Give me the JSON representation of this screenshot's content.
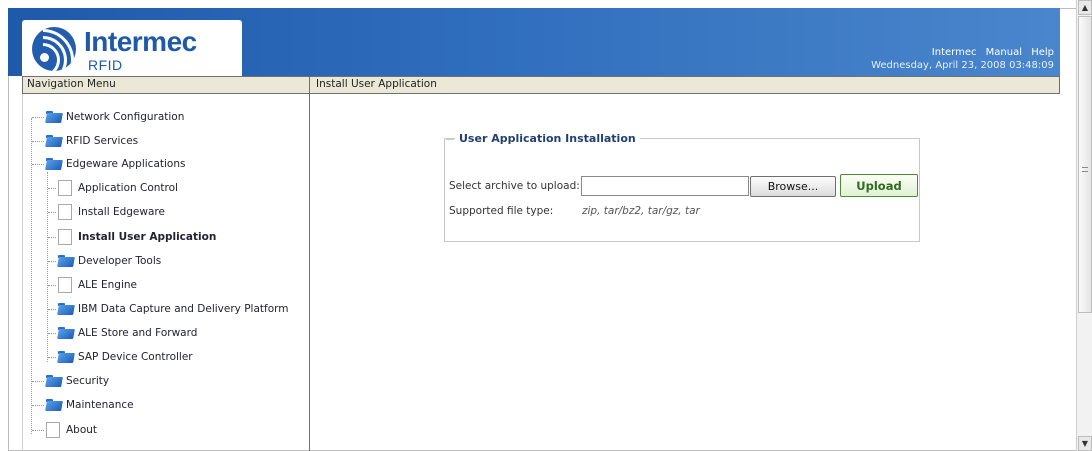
{
  "header": {
    "brand": "Intermec",
    "brand_sub": "RFID",
    "links": [
      "Intermec",
      "Manual",
      "Help"
    ],
    "datetime": "Wednesday, April 23, 2008 03:48:09"
  },
  "nav": {
    "title": "Navigation Menu",
    "items": [
      {
        "label": "Network Configuration",
        "icon": "folder-icon"
      },
      {
        "label": "RFID Services",
        "icon": "folder-icon"
      },
      {
        "label": "Edgeware Applications",
        "icon": "folder-icon"
      },
      {
        "label": "Application Control",
        "icon": "page-icon"
      },
      {
        "label": "Install Edgeware",
        "icon": "page-icon"
      },
      {
        "label": "Install User Application",
        "icon": "page-icon",
        "active": true
      },
      {
        "label": "Developer Tools",
        "icon": "folder-icon"
      },
      {
        "label": "ALE Engine",
        "icon": "page-icon"
      },
      {
        "label": "IBM Data Capture and Delivery Platform",
        "icon": "folder-icon"
      },
      {
        "label": "ALE Store and Forward",
        "icon": "folder-icon"
      },
      {
        "label": "SAP Device Controller",
        "icon": "folder-icon"
      },
      {
        "label": "Security",
        "icon": "folder-icon"
      },
      {
        "label": "Maintenance",
        "icon": "folder-icon"
      },
      {
        "label": "About",
        "icon": "page-icon"
      }
    ]
  },
  "main": {
    "title": "Install User Application",
    "form": {
      "legend": "User Application Installation",
      "select_label": "Select archive to upload:",
      "file_value": "",
      "browse_label": "Browse...",
      "upload_label": "Upload",
      "types_label": "Supported file type:",
      "types_value": "zip, tar/bz2, tar/gz, tar"
    }
  },
  "colors": {
    "header_blue": "#1f5aa8",
    "titlebar": "#ece8d8",
    "upload_green": "#2f6a1f"
  }
}
